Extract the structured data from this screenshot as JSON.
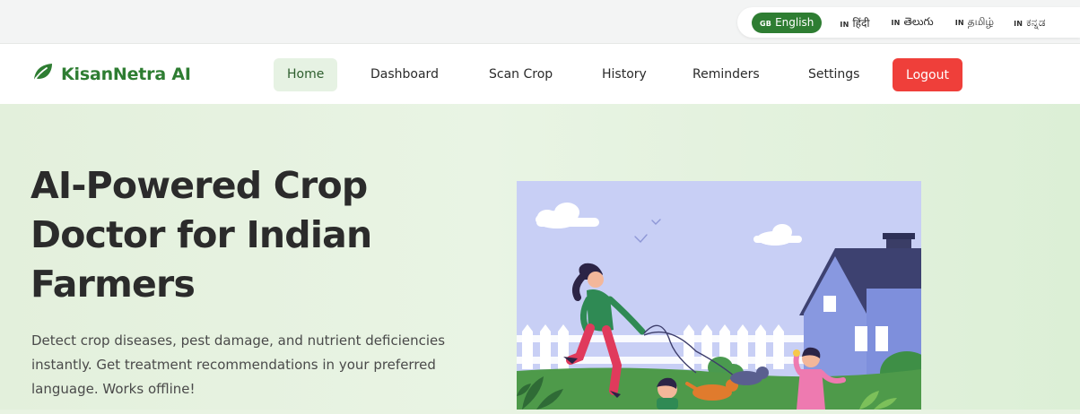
{
  "languages": [
    {
      "code": "GB",
      "label": "English",
      "active": true
    },
    {
      "code": "IN",
      "label": "हिंदी",
      "active": false
    },
    {
      "code": "IN",
      "label": "తెలుగు",
      "active": false
    },
    {
      "code": "IN",
      "label": "தமிழ்",
      "active": false
    },
    {
      "code": "IN",
      "label": "ಕನ್ನಡ",
      "active": false
    }
  ],
  "brand": {
    "name": "KisanNetra AI",
    "icon": "leaf-icon"
  },
  "nav": {
    "links": [
      "Home",
      "Dashboard",
      "Scan Crop",
      "History",
      "Reminders",
      "Settings"
    ],
    "active": "Home",
    "logout_label": "Logout"
  },
  "hero": {
    "title": "AI-Powered Crop Doctor for Indian Farmers",
    "description": "Detect crop diseases, pest damage, and nutrient deficiencies instantly. Get treatment recommendations in your preferred language. Works offline!"
  },
  "colors": {
    "brand_green": "#2e7d32",
    "logout_red": "#ef3f3a",
    "active_nav_bg": "#e6f2e3",
    "hero_bg": "#e6f2e0",
    "illustration_sky": "#c8cff5"
  }
}
